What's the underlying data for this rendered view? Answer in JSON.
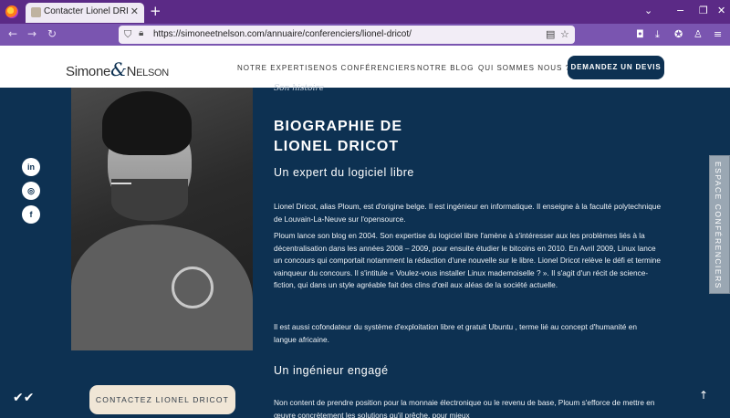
{
  "browser": {
    "tab_title": "Contacter Lionel DRICOT",
    "tab_close": "✕",
    "new_tab": "+",
    "url": "https://simoneetnelson.com/annuaire/conferenciers/lionel-dricot/",
    "icons": [
      "firefox-icon",
      "back-icon",
      "forward-icon",
      "reload-icon",
      "shield-icon",
      "lock-icon",
      "reader-icon",
      "bookmark-star-icon",
      "pocket-icon",
      "download-icon",
      "extension-icon",
      "extension2-icon",
      "menu-icon",
      "chevron-down-icon",
      "minimize-icon",
      "maximize-icon",
      "close-window-icon"
    ]
  },
  "site": {
    "logo_left": "Simone",
    "logo_amp": "&",
    "logo_right": "Nelson",
    "menu": [
      "NOTRE EXPERTISE",
      "NOS CONFÉRENCIERS",
      "NOTRE BLOG",
      "QUI SOMMES NOUS ?"
    ],
    "cta": "DEMANDEZ UN DEVIS"
  },
  "content": {
    "section_tag": "Son histoire",
    "title_line1": "BIOGRAPHIE DE",
    "title_line2": "LIONEL DRICOT",
    "subtitle1": "Un expert du logiciel libre",
    "para1": "Lionel Dricot, alias Ploum, est d'origine belge. Il est ingénieur en informatique. Il enseigne à la faculté polytechnique de Louvain-La-Neuve sur l'opensource.",
    "para2": "Ploum lance son blog en 2004. Son expertise du logiciel libre l'amène à s'intéresser aux les problèmes liés à la décentralisation dans les années 2008 – 2009, pour ensuite étudier le bitcoins en 2010. En Avril 2009, Linux lance un concours qui comportait notamment la rédaction d'une nouvelle sur le libre. Lionel Dricot relève le défi et termine vainqueur du concours. Il s'intitule « Voulez-vous installer Linux mademoiselle ? ». Il s'agit d'un récit de science- fiction, qui dans un style agréable fait des clins d'œil aux aléas de la société actuelle.",
    "para3": "Il est aussi cofondateur du système d'exploitation libre et gratuit Ubuntu , terme lié au concept d'humanité en langue africaine.",
    "subtitle2": "Un ingénieur engagé",
    "para4": "Non content de prendre position pour la monnaie électronique ou le revenu de base, Ploum s'efforce de mettre en œuvre concrètement les solutions qu'il prêche, pour mieux"
  },
  "social": {
    "linkedin": "in",
    "instagram": "◎",
    "facebook": "f"
  },
  "side_tab": "ESPACE CONFÉRENCIERS",
  "contact_button": "CONTACTEZ LIONEL DRICOT",
  "colors": {
    "page_bg": "#0d3152",
    "tab_strip": "#5b2a86",
    "nav_bar": "#7a55b0",
    "contact_btn": "#f0e6d6",
    "side_tab": "#9aa7b3"
  }
}
